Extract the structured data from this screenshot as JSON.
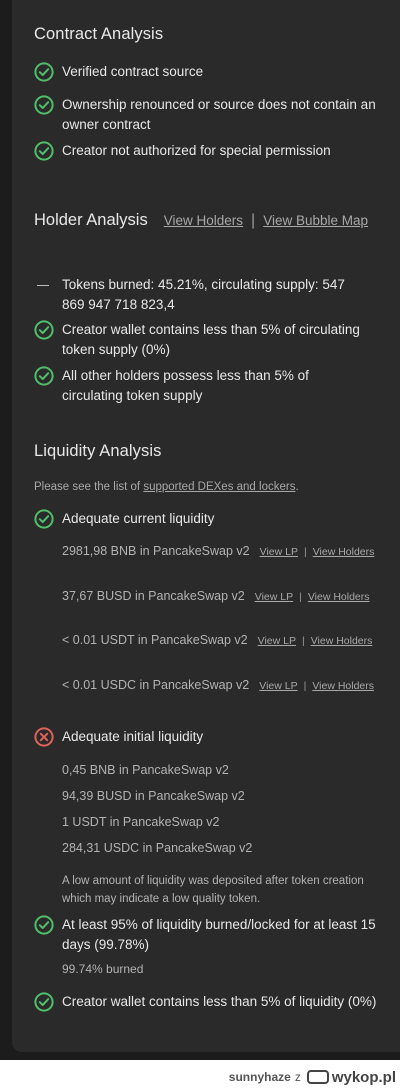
{
  "contract": {
    "title": "Contract Analysis",
    "items": [
      {
        "status": "ok",
        "text": "Verified contract source"
      },
      {
        "status": "ok",
        "text": "Ownership renounced or source does not contain an owner contract"
      },
      {
        "status": "ok",
        "text": "Creator not authorized for special permission"
      }
    ]
  },
  "holder": {
    "title": "Holder Analysis",
    "view_holders": "View Holders",
    "separator": "|",
    "view_bubble_map": "View Bubble Map",
    "items": [
      {
        "status": "neutral",
        "text": "Tokens burned: 45.21%, circulating supply: 547 869 947 718 823,4"
      },
      {
        "status": "ok",
        "text": "Creator wallet contains less than 5% of circulating token supply (0%)"
      },
      {
        "status": "ok",
        "text": "All other holders possess less than 5% of circulating token supply"
      }
    ]
  },
  "liquidity": {
    "title": "Liquidity Analysis",
    "note_prefix": "Please see the list of ",
    "note_link": "supported DEXes and lockers",
    "note_suffix": ".",
    "current": {
      "status": "ok",
      "text": "Adequate current liquidity",
      "pools": [
        {
          "text": "2981,98 BNB in PancakeSwap v2",
          "lp": "View LP",
          "holders": "View Holders"
        },
        {
          "text": "37,67 BUSD in PancakeSwap v2",
          "lp": "View LP",
          "holders": "View Holders"
        },
        {
          "text": "< 0.01 USDT in PancakeSwap v2",
          "lp": "View LP",
          "holders": "View Holders"
        },
        {
          "text": "< 0.01 USDC in PancakeSwap v2",
          "lp": "View LP",
          "holders": "View Holders"
        }
      ]
    },
    "initial": {
      "status": "fail",
      "text": "Adequate initial liquidity",
      "pools": [
        "0,45 BNB in PancakeSwap v2",
        "94,39 BUSD in PancakeSwap v2",
        "1 USDT in PancakeSwap v2",
        "284,31 USDC in PancakeSwap v2"
      ],
      "warning": "A low amount of liquidity was deposited after token creation which may indicate a low quality token."
    },
    "burned": {
      "status": "ok",
      "text": "At least 95% of liquidity burned/locked for at least 15 days (99.78%)",
      "sub": "99.74% burned"
    },
    "creator": {
      "status": "ok",
      "text": "Creator wallet contains less than 5% of liquidity (0%)"
    }
  },
  "footer": {
    "user": "sunnyhaze",
    "z": "z",
    "brand": "wykop.pl"
  },
  "colors": {
    "ok": "#4fbf6a",
    "fail": "#e0625a",
    "panel": "#2a2a2a"
  }
}
